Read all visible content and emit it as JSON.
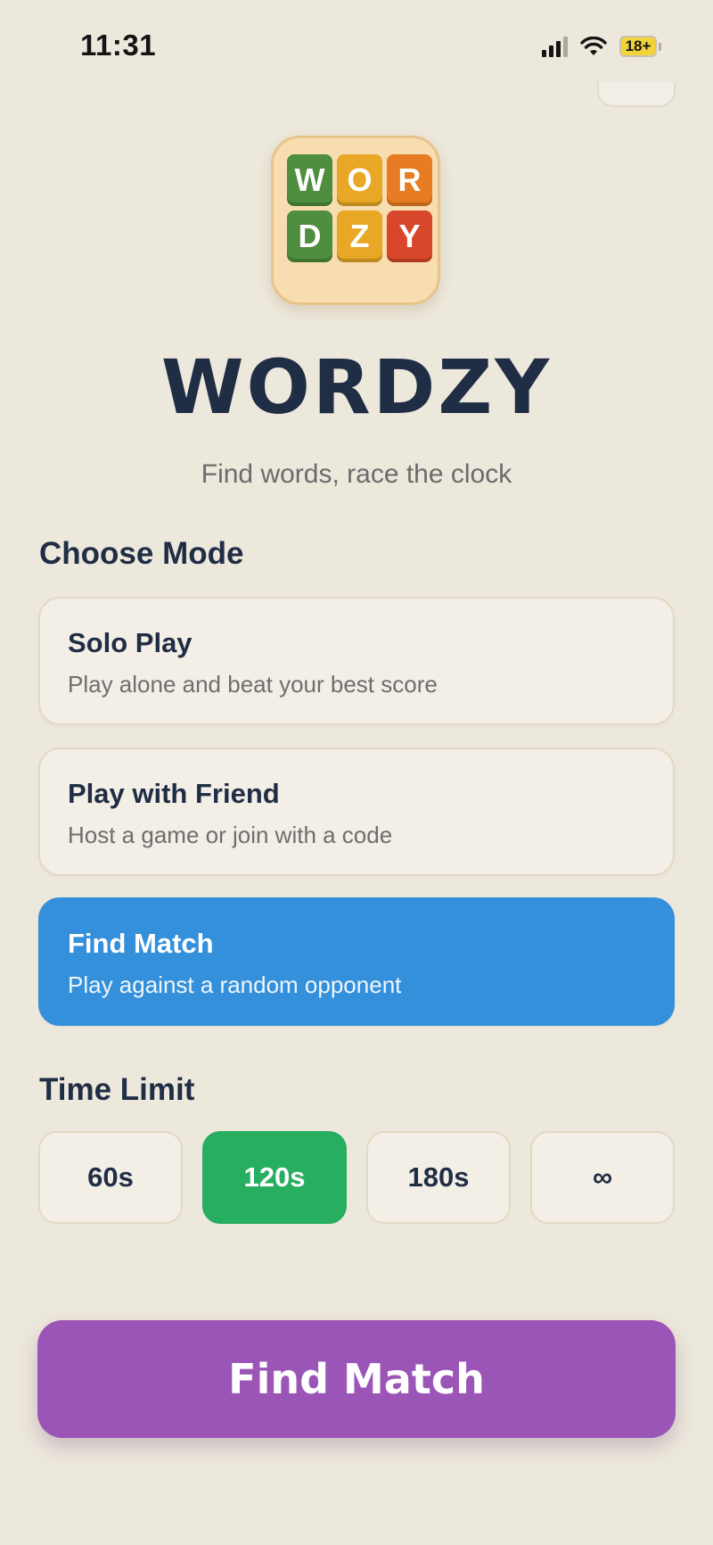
{
  "status_bar": {
    "time": "11:31",
    "battery": "18+",
    "icons": [
      "signal-icon",
      "wifi-icon",
      "battery-icon"
    ]
  },
  "logo": {
    "tiles": [
      {
        "letter": "W",
        "color": "#4E8E3E"
      },
      {
        "letter": "O",
        "color": "#E8A825"
      },
      {
        "letter": "R",
        "color": "#E87C22"
      },
      {
        "letter": "D",
        "color": "#4E8E3E"
      },
      {
        "letter": "Z",
        "color": "#E8A825"
      },
      {
        "letter": "Y",
        "color": "#D9472A"
      }
    ]
  },
  "app": {
    "title": "WORDZY",
    "subtitle": "Find words, race the clock"
  },
  "modes": {
    "section_label": "Choose Mode",
    "items": [
      {
        "title": "Solo Play",
        "description": "Play alone and beat your best score",
        "selected": false
      },
      {
        "title": "Play with Friend",
        "description": "Host a game or join with a code",
        "selected": false
      },
      {
        "title": "Find Match",
        "description": "Play against a random opponent",
        "selected": true
      }
    ]
  },
  "time_limit": {
    "section_label": "Time Limit",
    "options": [
      {
        "label": "60s",
        "selected": false
      },
      {
        "label": "120s",
        "selected": true
      },
      {
        "label": "180s",
        "selected": false
      },
      {
        "label": "∞",
        "selected": false
      }
    ]
  },
  "cta": {
    "label": "Find Match"
  },
  "colors": {
    "background": "#EDE8DC",
    "navy_text": "#1F2D45",
    "mode_selected": "#3490DA",
    "time_selected": "#27AE60",
    "cta": "#9B55B7"
  }
}
